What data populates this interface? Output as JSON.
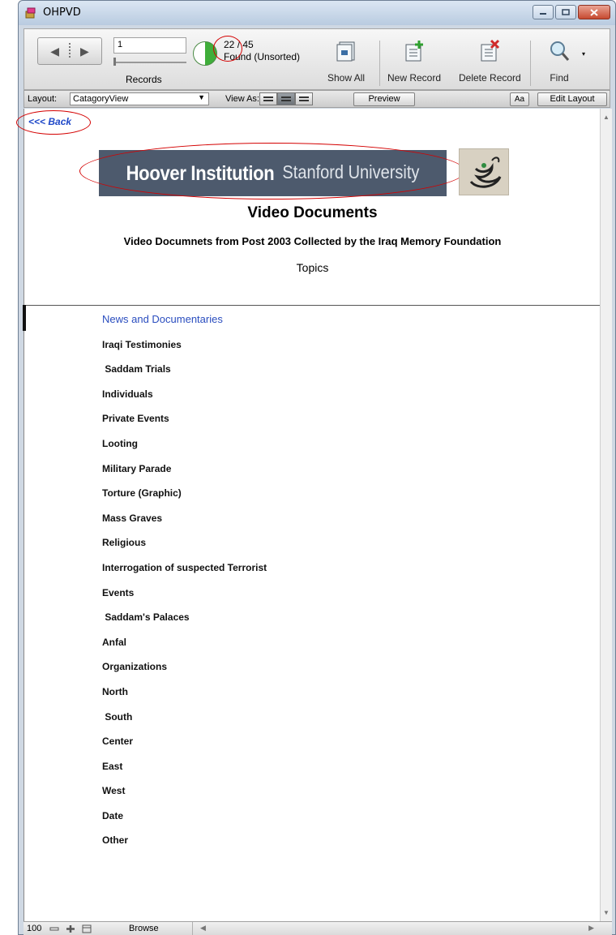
{
  "window": {
    "title": "OHPVD",
    "controls": [
      "minimize",
      "maximize",
      "close"
    ]
  },
  "toolbar": {
    "record_input": "1",
    "records_label": "Records",
    "found_current": "22",
    "found_total": "45",
    "found_status": "Found (Unsorted)",
    "show_all_label": "Show All",
    "new_record_label": "New Record",
    "delete_record_label": "Delete Record",
    "find_label": "Find"
  },
  "layoutbar": {
    "layout_label": "Layout:",
    "layout_value": "CatagoryView",
    "view_as_label": "View As:",
    "preview_label": "Preview",
    "aa_label": "Aa",
    "edit_layout_label": "Edit Layout"
  },
  "content": {
    "back_link": "<<< Back",
    "banner_bold": "Hoover Institution",
    "banner_regular": "Stanford University",
    "title": "Video Documents",
    "subtitle": "Video Documnets from Post 2003 Collected by the Iraq Memory Foundation",
    "topics_heading": "Topics",
    "topics": [
      "News and Documentaries",
      "Iraqi Testimonies",
      " Saddam Trials",
      "Individuals",
      "Private Events",
      "Looting",
      "Military Parade",
      "Torture (Graphic)",
      "Mass Graves",
      "Religious",
      "Interrogation of suspected Terrorist",
      "Events",
      " Saddam's Palaces",
      "Anfal",
      "Organizations",
      "North",
      " South",
      "Center",
      "East",
      "West",
      "Date",
      "Other"
    ]
  },
  "statusbar": {
    "zoom": "100",
    "mode": "Browse"
  },
  "colors": {
    "annotation_red": "#d40000",
    "link_blue": "#1f48c8",
    "banner_bg": "#4d5a6d"
  }
}
